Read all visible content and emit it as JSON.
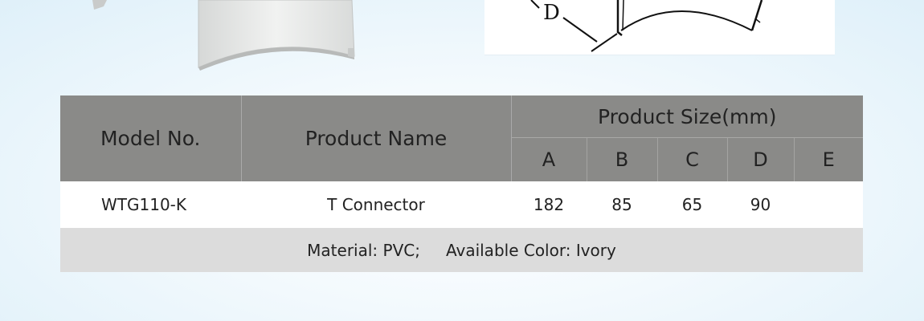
{
  "diagram": {
    "dimension_label": "D"
  },
  "table": {
    "headers": {
      "model": "Model No.",
      "product_name": "Product Name",
      "size_group": "Product Size(mm)",
      "sizes": [
        "A",
        "B",
        "C",
        "D",
        "E"
      ]
    },
    "rows": [
      {
        "model": "WTG110-K",
        "product_name": "T Connector",
        "sizes": [
          "182",
          "85",
          "65",
          "90",
          ""
        ]
      }
    ],
    "note": {
      "material": "Material:  PVC;",
      "color": "Available Color: Ivory"
    }
  }
}
